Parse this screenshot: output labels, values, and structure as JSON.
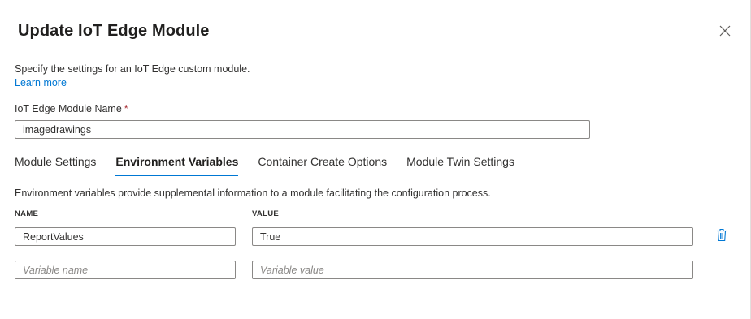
{
  "dialog": {
    "title": "Update IoT Edge Module",
    "description": "Specify the settings for an IoT Edge custom module.",
    "learn_more": "Learn more"
  },
  "module_name": {
    "label": "IoT Edge Module Name",
    "required_mark": "*",
    "value": "imagedrawings"
  },
  "tabs": [
    {
      "label": "Module Settings",
      "active": false
    },
    {
      "label": "Environment Variables",
      "active": true
    },
    {
      "label": "Container Create Options",
      "active": false
    },
    {
      "label": "Module Twin Settings",
      "active": false
    }
  ],
  "env": {
    "description": "Environment variables provide supplemental information to a module facilitating the configuration process.",
    "name_header": "NAME",
    "value_header": "VALUE",
    "rows": [
      {
        "name": "ReportValues",
        "value": "True"
      }
    ],
    "new_row": {
      "name_placeholder": "Variable name",
      "value_placeholder": "Variable value"
    }
  },
  "icons": {
    "close": "close-icon",
    "delete": "trash-icon"
  },
  "colors": {
    "accent": "#0078d4",
    "required": "#a4262c",
    "border": "#8a8886"
  }
}
